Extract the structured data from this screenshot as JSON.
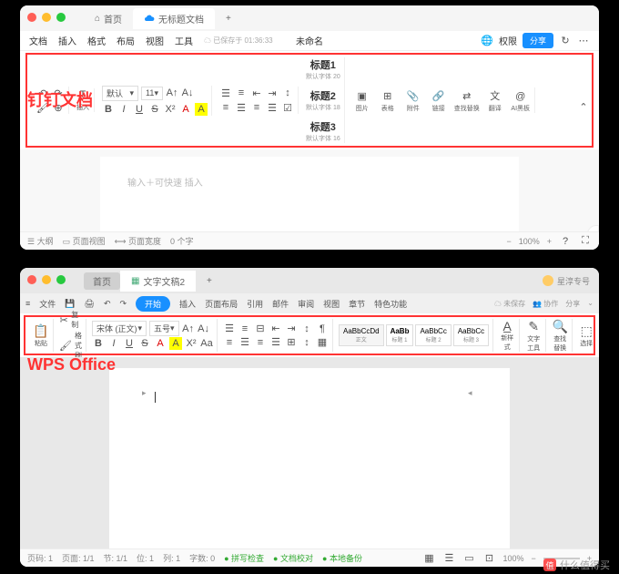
{
  "dingtalk": {
    "label": "钉钉文档",
    "tabs": {
      "home": "首页",
      "doc": "无标题文档"
    },
    "menu": {
      "file": "文档",
      "insert": "插入",
      "format": "格式",
      "layout": "布局",
      "view": "视图",
      "tools": "工具",
      "saved": "已保存于 01:36:33",
      "title": "未命名",
      "perm": "权限",
      "share": "分享"
    },
    "toolbar": {
      "font_default": "默认",
      "font_size": "11",
      "headings": [
        {
          "t": "标题1",
          "s": "默认字体 20"
        },
        {
          "t": "标题2",
          "s": "默认字体 18"
        },
        {
          "t": "标题3",
          "s": "默认字体 16"
        }
      ],
      "tools": {
        "image": "图片",
        "table": "表格",
        "attach": "附件",
        "link": "链接",
        "findreplace": "查找替换",
        "translate": "翻译",
        "paste": "AI黑板"
      },
      "insert": "插入"
    },
    "placeholder": "输入＋可快速 插入",
    "status": {
      "outline": "大纲",
      "pagewidth": "页面视图",
      "pagew": "页面宽度",
      "words": "0 个字",
      "zoom": "100%"
    }
  },
  "wps": {
    "label": "WPS Office",
    "tabs": {
      "home": "首页",
      "doc": "文字文稿2"
    },
    "user": "星淳专号",
    "menu": {
      "file": "文件",
      "start": "开始",
      "insert": "插入",
      "layout": "页面布局",
      "ref": "引用",
      "mail": "邮件",
      "review": "审阅",
      "view": "视图",
      "chapter": "章节",
      "special": "特色功能",
      "unsaved": "未保存",
      "coop": "协作",
      "share": "分享"
    },
    "toolbar": {
      "paste": "粘贴",
      "copy": "复制",
      "brush": "格式刷",
      "font": "宋体 (正文)",
      "size": "五号",
      "styles": [
        {
          "preview": "AaBbCcDd",
          "name": "正文"
        },
        {
          "preview": "AaBb",
          "name": "标题 1"
        },
        {
          "preview": "AaBbCc",
          "name": "标题 2"
        },
        {
          "preview": "AaBbCc",
          "name": "标题 3"
        }
      ],
      "newstyle": "新样式",
      "textool": "文字工具",
      "findreplace": "查找替换",
      "select": "选择"
    },
    "status": {
      "page": "页码: 1",
      "pg": "页面: 1/1",
      "sec": "节: 1/1",
      "pos": "位: 1",
      "col": "列: 1",
      "words": "字数: 0",
      "spell": "拼写检查",
      "support": "文档校对",
      "backup": "本地备份",
      "zoom": "100%"
    }
  },
  "watermark": "什么值得买"
}
